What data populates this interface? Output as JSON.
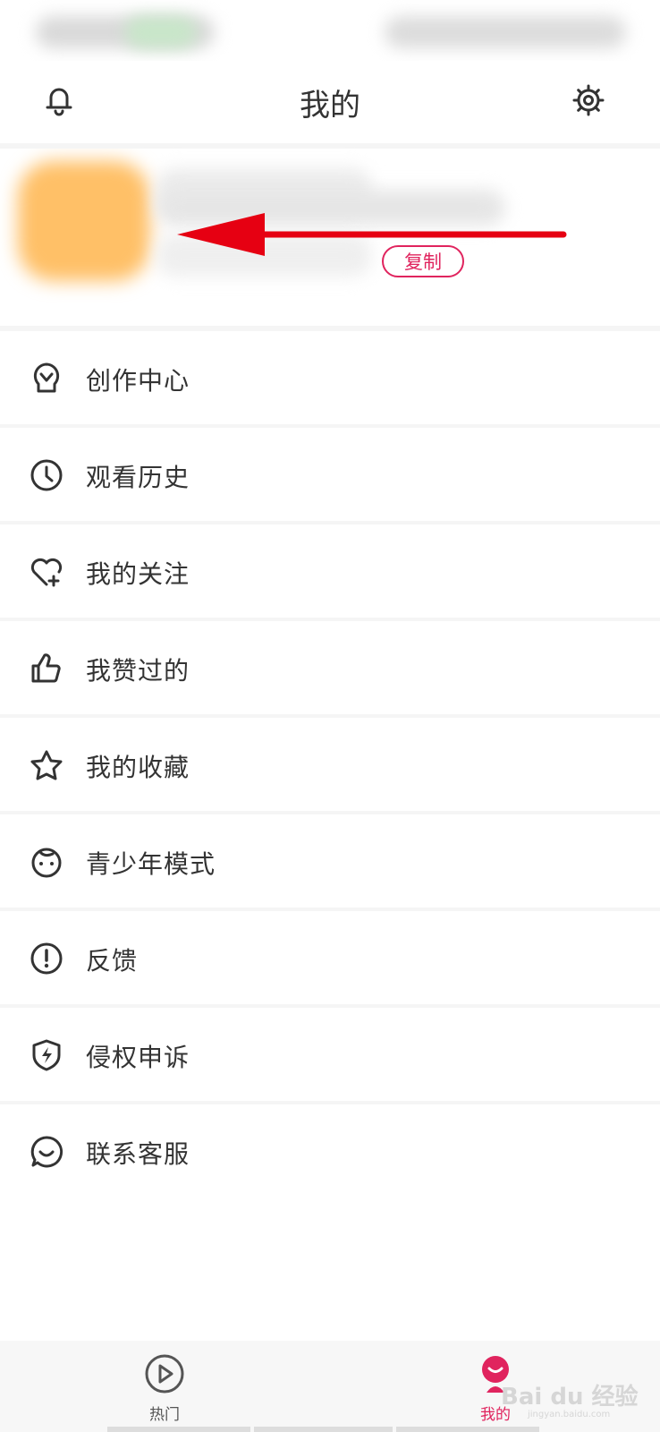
{
  "header": {
    "title": "我的"
  },
  "profile": {
    "copy_label": "复制"
  },
  "menu": [
    {
      "label": "创作中心",
      "icon": "bulb-icon"
    },
    {
      "label": "观看历史",
      "icon": "clock-icon"
    },
    {
      "label": "我的关注",
      "icon": "heart-plus-icon"
    },
    {
      "label": "我赞过的",
      "icon": "thumbs-up-icon"
    },
    {
      "label": "我的收藏",
      "icon": "star-icon"
    },
    {
      "label": "青少年模式",
      "icon": "baby-face-icon"
    },
    {
      "label": "反馈",
      "icon": "exclamation-icon"
    },
    {
      "label": "侵权申诉",
      "icon": "shield-bolt-icon"
    },
    {
      "label": "联系客服",
      "icon": "chat-smile-icon"
    }
  ],
  "tabbar": {
    "tabs": [
      {
        "label": "热门",
        "icon": "play-circle-icon",
        "active": false
      },
      {
        "label": "我的",
        "icon": "profile-icon",
        "active": true
      }
    ]
  },
  "watermark": {
    "text": "Bai du 经验",
    "sub": "jingyan.baidu.com"
  },
  "colors": {
    "accent": "#e0245e",
    "arrow": "#e60012",
    "text": "#333333",
    "icon": "#333333"
  }
}
